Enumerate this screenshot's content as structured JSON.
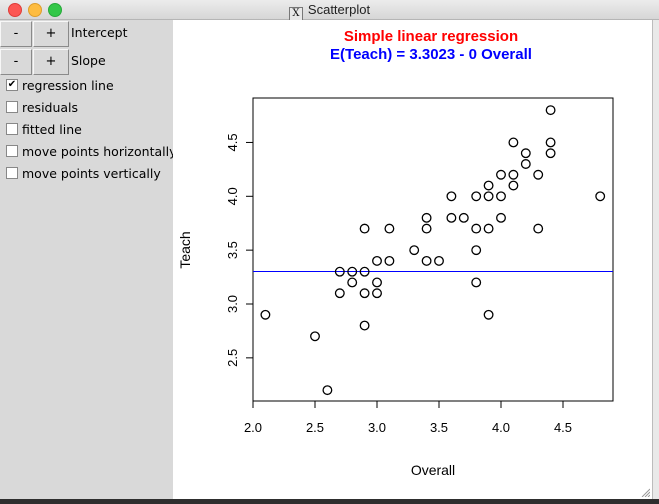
{
  "window": {
    "title": "Scatterplot",
    "app_icon": "x11-icon"
  },
  "controls": {
    "intercept": {
      "minus_label": "-",
      "plus_label": "+",
      "label": "Intercept"
    },
    "slope": {
      "minus_label": "-",
      "plus_label": "+",
      "label": "Slope"
    },
    "checkboxes": [
      {
        "label": "regression line",
        "checked": true
      },
      {
        "label": "residuals",
        "checked": false
      },
      {
        "label": "fitted line",
        "checked": false
      },
      {
        "label": "move points horizontally",
        "checked": false
      },
      {
        "label": "move points vertically",
        "checked": false
      }
    ]
  },
  "colors": {
    "title": "#ff0000",
    "subtitle": "#0000ff",
    "regression_line": "#0000ff",
    "points": "#000000"
  },
  "chart_data": {
    "type": "scatter",
    "title": "Simple linear regression",
    "subtitle": "E(Teach) = 3.3023 - 0 Overall",
    "xlabel": "Overall",
    "ylabel": "Teach",
    "xlim": [
      1.99,
      4.9
    ],
    "ylim": [
      2.1,
      4.9
    ],
    "xticks": [
      2.0,
      2.5,
      3.0,
      3.5,
      4.0,
      4.5
    ],
    "xtick_labels": [
      "2.0",
      "2.5",
      "3.0",
      "3.5",
      "4.0",
      "4.5"
    ],
    "yticks": [
      2.5,
      3.0,
      3.5,
      4.0,
      4.5
    ],
    "ytick_labels": [
      "2.5",
      "3.0",
      "3.5",
      "4.0",
      "4.5"
    ],
    "grid": false,
    "regression": {
      "intercept": 3.3023,
      "slope": 0
    },
    "points": [
      [
        2.1,
        2.9
      ],
      [
        2.5,
        2.7
      ],
      [
        2.6,
        2.2
      ],
      [
        2.7,
        3.3
      ],
      [
        2.7,
        3.1
      ],
      [
        2.8,
        3.3
      ],
      [
        2.8,
        3.2
      ],
      [
        2.9,
        3.7
      ],
      [
        2.9,
        3.3
      ],
      [
        2.9,
        3.1
      ],
      [
        2.9,
        2.8
      ],
      [
        3.0,
        3.4
      ],
      [
        3.0,
        3.2
      ],
      [
        3.0,
        3.1
      ],
      [
        3.1,
        3.7
      ],
      [
        3.1,
        3.4
      ],
      [
        3.3,
        3.5
      ],
      [
        3.4,
        3.8
      ],
      [
        3.4,
        3.7
      ],
      [
        3.4,
        3.4
      ],
      [
        3.5,
        3.4
      ],
      [
        3.6,
        4.0
      ],
      [
        3.6,
        3.8
      ],
      [
        3.7,
        3.8
      ],
      [
        3.8,
        4.0
      ],
      [
        3.8,
        3.7
      ],
      [
        3.8,
        3.5
      ],
      [
        3.8,
        3.2
      ],
      [
        3.9,
        4.1
      ],
      [
        3.9,
        4.0
      ],
      [
        3.9,
        3.7
      ],
      [
        3.9,
        2.9
      ],
      [
        4.0,
        4.2
      ],
      [
        4.0,
        4.0
      ],
      [
        4.0,
        3.8
      ],
      [
        4.1,
        4.5
      ],
      [
        4.1,
        4.2
      ],
      [
        4.1,
        4.1
      ],
      [
        4.2,
        4.4
      ],
      [
        4.2,
        4.3
      ],
      [
        4.3,
        4.2
      ],
      [
        4.3,
        3.7
      ],
      [
        4.4,
        4.8
      ],
      [
        4.4,
        4.5
      ],
      [
        4.4,
        4.4
      ],
      [
        4.8,
        4.0
      ]
    ]
  }
}
